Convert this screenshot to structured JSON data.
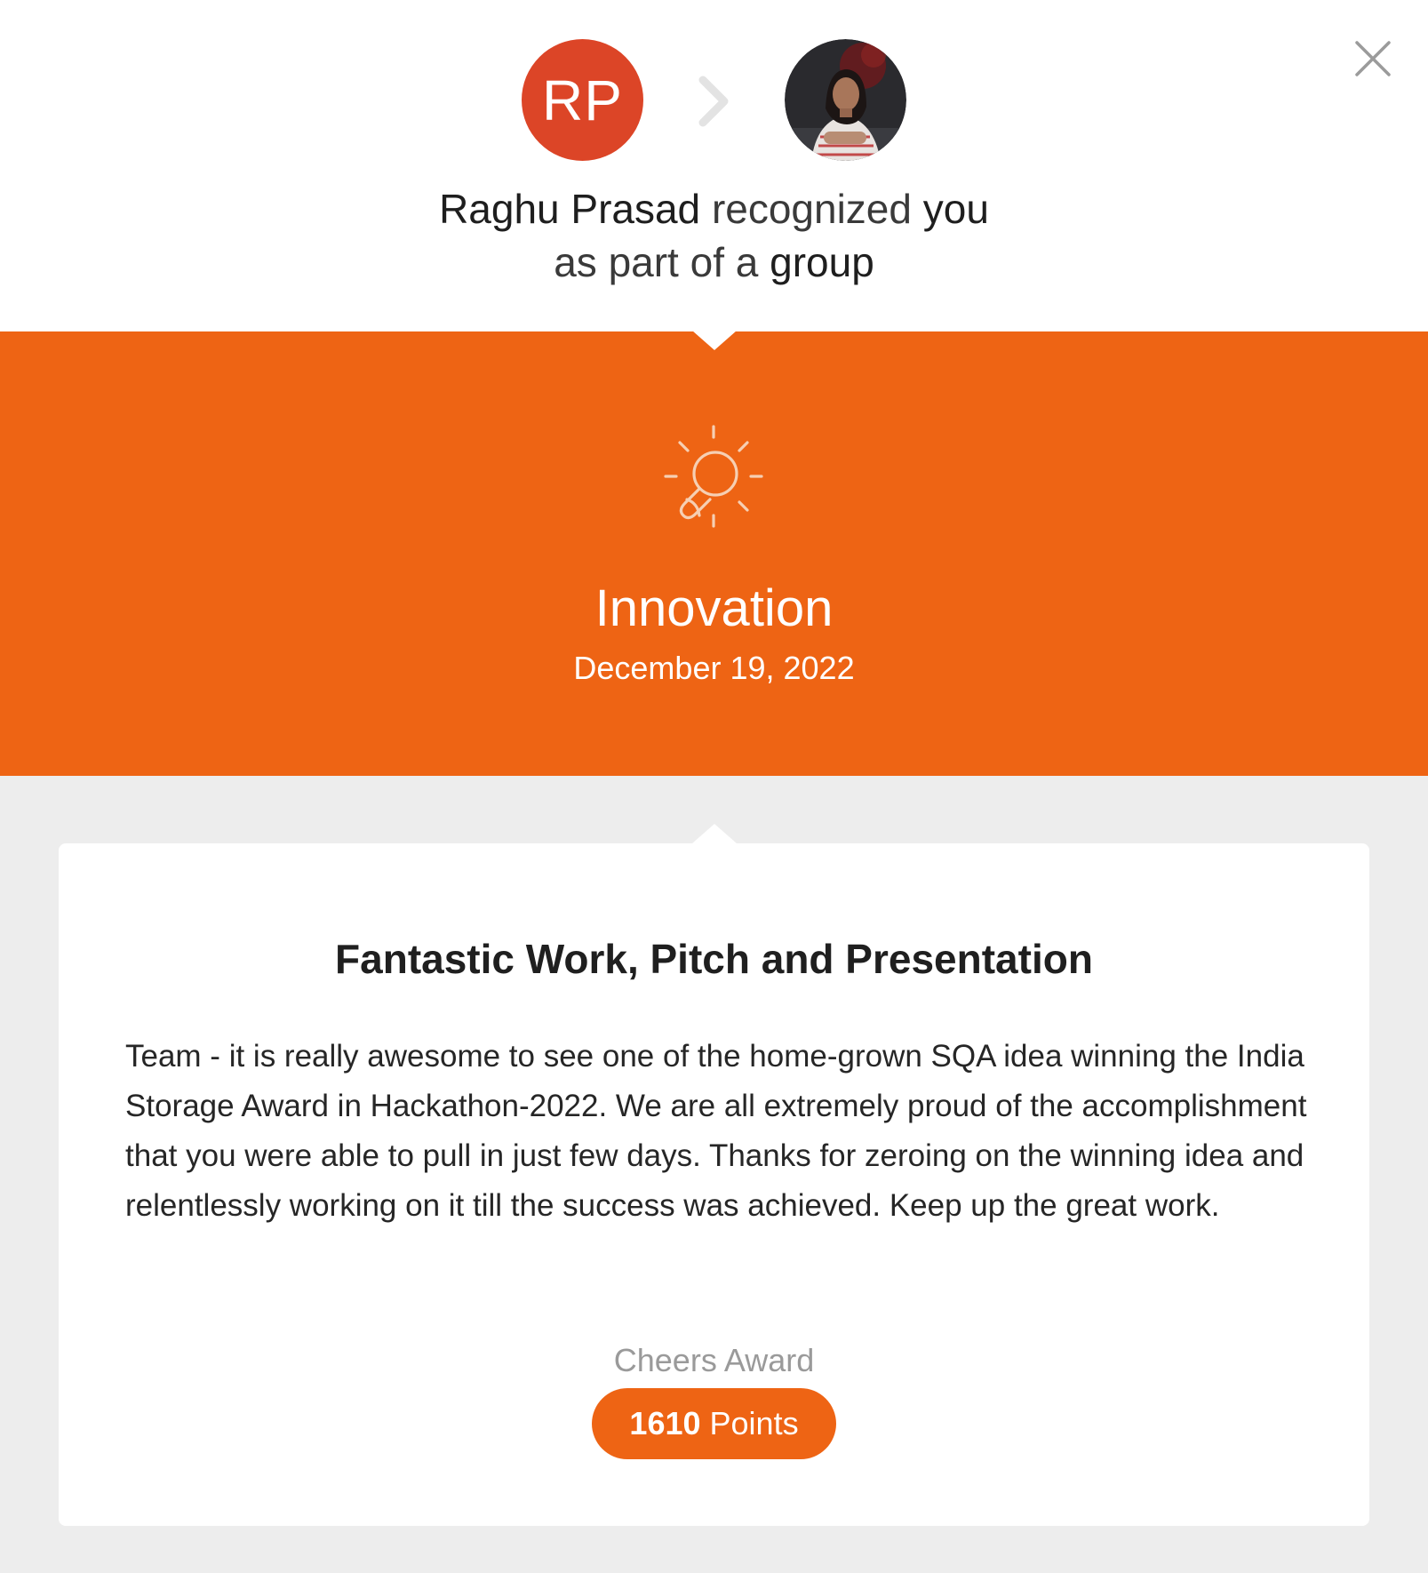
{
  "header": {
    "giver_initials": "RP",
    "giver_name": "Raghu Prasad",
    "verb": "recognized",
    "recipient": "you",
    "line2_prefix": "as part of a",
    "line2_group": "group"
  },
  "colors": {
    "accent": "#ee6414",
    "giver_avatar": "#dc4527",
    "page_background": "#ededed"
  },
  "category": {
    "icon": "lightbulb-idea-icon",
    "name": "Innovation",
    "date": "December 19, 2022"
  },
  "card": {
    "title": "Fantastic Work, Pitch and Presentation",
    "message": "Team - it is really awesome to see one of the home-grown SQA idea winning the India Storage Award in Hackathon-2022. We are all extremely proud of the accomplishment that you were able to pull in just few days. Thanks for zeroing on the winning idea and relentlessly working on it till the success was achieved. Keep up the great work.",
    "award_label": "Cheers Award",
    "points_value": "1610",
    "points_unit": "Points"
  }
}
